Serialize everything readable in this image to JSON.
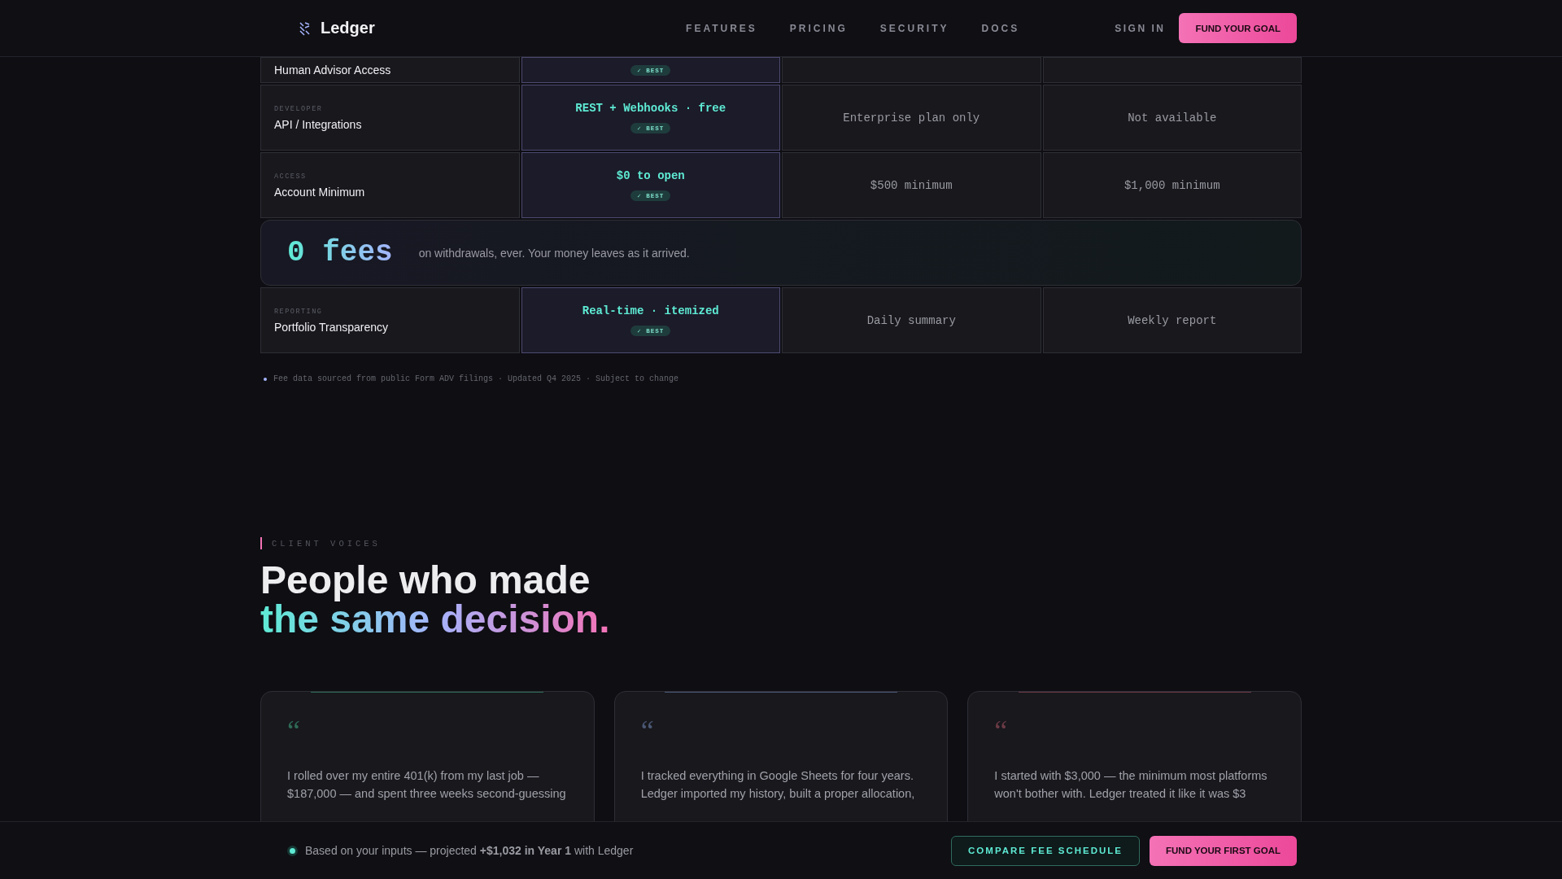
{
  "nav": {
    "brand": "Ledger",
    "links": [
      "FEATURES",
      "PRICING",
      "SECURITY",
      "DOCS"
    ],
    "sign_in": "SIGN IN",
    "cta": "FUND YOUR GOAL"
  },
  "comparison": {
    "rows": [
      {
        "kind": "feature",
        "label": "Human Advisor Access",
        "ours": {
          "badge": "✓ BEST"
        },
        "others": []
      },
      {
        "kind": "feature",
        "category": "DEVELOPER",
        "label": "API / Integrations",
        "ours": {
          "value": "REST + Webhooks · free",
          "badge": "✓ BEST"
        },
        "others": [
          "Enterprise plan only",
          "Not available"
        ]
      },
      {
        "kind": "feature",
        "category": "ACCESS",
        "label": "Account Minimum",
        "ours": {
          "value": "$0 to open",
          "badge": "✓ BEST"
        },
        "others": [
          "$500 minimum",
          "$1,000 minimum"
        ]
      },
      {
        "kind": "banner",
        "figure": "0 fees",
        "text": "on withdrawals, ever. Your money leaves as it arrived."
      },
      {
        "kind": "feature",
        "category": "REPORTING",
        "label": "Portfolio Transparency",
        "ours": {
          "value": "Real-time · itemized",
          "badge": "✓ BEST"
        },
        "others": [
          "Daily summary",
          "Weekly report"
        ]
      }
    ],
    "footnote": "Fee data sourced from public Form ADV filings · Updated Q4 2025 · Subject to change"
  },
  "voices": {
    "eyebrow": "CLIENT VOICES",
    "heading": "People who made",
    "heading_accent": "the same decision.",
    "testimonials": [
      {
        "color": "#2f6b55",
        "mark": "“",
        "lines": [
          "I rolled over my entire 401(k) from my last job —",
          "$187,000 — and spent three weeks second-guessing"
        ]
      },
      {
        "color": "#4a5873",
        "mark": "“",
        "lines": [
          "I tracked everything in Google Sheets for four years.",
          "Ledger imported my history, built a proper allocation,"
        ]
      },
      {
        "color": "#6b3a45",
        "mark": "“",
        "lines": [
          "I started with $3,000 — the minimum most platforms",
          "won't bother with. Ledger treated it like it was $3"
        ]
      }
    ]
  },
  "bottom_bar": {
    "text": "Based on your inputs — projected **+$1,032 in Year 1** with Ledger",
    "secondary": "COMPARE FEE SCHEDULE",
    "primary": "FUND YOUR FIRST GOAL"
  }
}
